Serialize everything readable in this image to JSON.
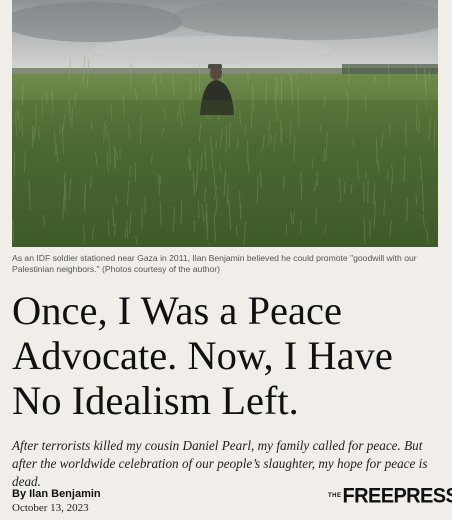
{
  "photo": {
    "alt_icon": "wheat-field-photo"
  },
  "caption": "As an IDF soldier stationed near Gaza in 2011, Ilan Benjamin believed he could promote \"goodwill with our Palestinian neighbors.\" (Photos courtesy of the author)",
  "headline": "Once, I Was a Peace Advocate. Now, I Have No Idealism Left.",
  "dek": "After terrorists killed my cousin Daniel Pearl, my family called for peace. But after the worldwide celebration of our people’s slaughter, my hope for peace is dead.",
  "byline": "By Ilan Benjamin",
  "date": "October 13, 2023",
  "logo": {
    "the": "THE",
    "word": "FREEPRESS"
  }
}
